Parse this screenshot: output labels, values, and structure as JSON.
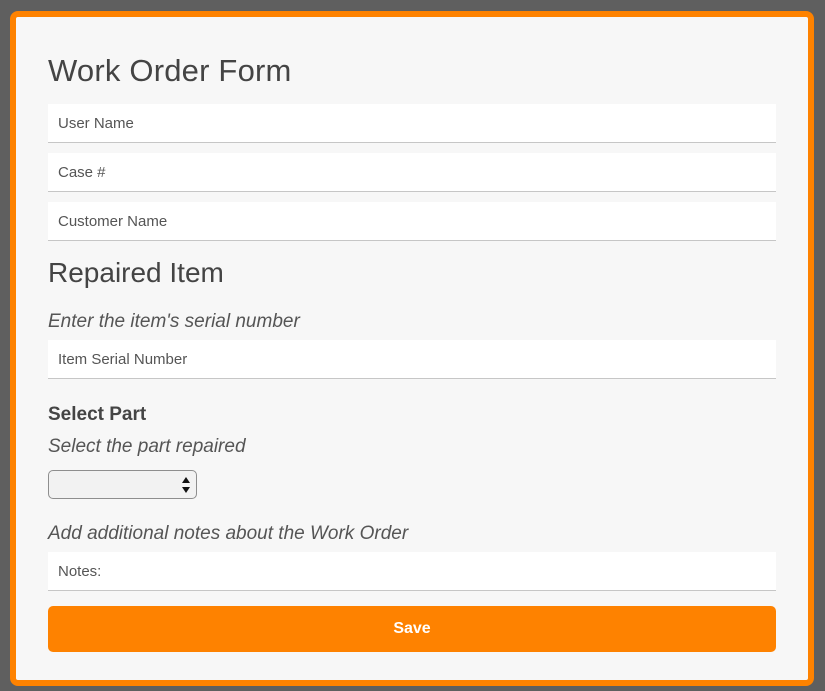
{
  "form": {
    "title": "Work Order Form",
    "user_name_placeholder": "User Name",
    "case_placeholder": "Case #",
    "customer_name_placeholder": "Customer Name"
  },
  "repaired_item": {
    "title": "Repaired Item",
    "serial_hint": "Enter the item's serial number",
    "serial_placeholder": "Item Serial Number"
  },
  "part": {
    "label": "Select Part",
    "hint": "Select the part repaired",
    "selected_value": ""
  },
  "notes": {
    "hint": "Add additional notes about the Work Order",
    "placeholder": "Notes:"
  },
  "actions": {
    "save_label": "Save"
  },
  "colors": {
    "accent": "#fe8200",
    "page_background": "#5f5f5f",
    "panel_background": "#f7f7f7"
  }
}
